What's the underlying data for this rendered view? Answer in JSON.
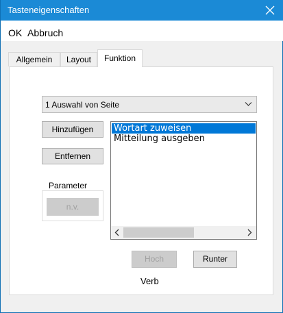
{
  "window": {
    "title": "Tasteneigenschaften"
  },
  "menu": {
    "ok": "OK",
    "cancel": "Abbruch"
  },
  "tabs": [
    {
      "label": "Allgemein",
      "active": false
    },
    {
      "label": "Layout",
      "active": false
    },
    {
      "label": "Funktion",
      "active": true
    }
  ],
  "function_tab": {
    "selection_combo": {
      "value": "1 Auswahl von Seite"
    },
    "add_button": "Hinzufügen",
    "remove_button": "Entfernen",
    "parameter_group": {
      "label": "Parameter",
      "button": "n.v."
    },
    "action_list": {
      "items": [
        {
          "label": "Wortart zuweisen",
          "selected": true
        },
        {
          "label": "Mitteilung ausgeben",
          "selected": false
        }
      ]
    },
    "up_button": "Hoch",
    "down_button": "Runter",
    "detail_label": "Verb"
  },
  "colors": {
    "titlebar": "#1b8ad6",
    "selection": "#0078d7"
  },
  "icons": {
    "close": "close-icon",
    "combo_arrow": "chevron-down-icon",
    "scroll_left": "chevron-left-icon",
    "scroll_right": "chevron-right-icon"
  }
}
